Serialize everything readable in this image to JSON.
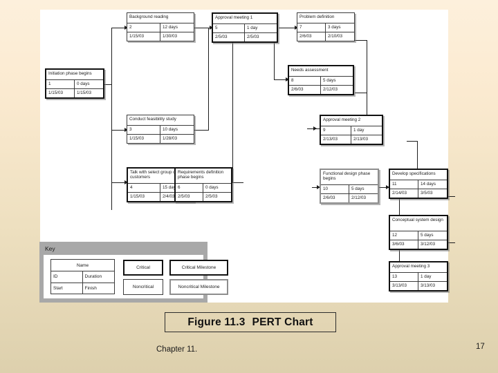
{
  "slide": {
    "caption_label": "Figure 11.3",
    "caption_text": "PERT Chart",
    "footer_chapter": "Chapter 11.",
    "page_number": "17",
    "background_top_color": "#fdf0dc",
    "background_bottom_color": "#ddd0ad",
    "canvas_color": "#ffffff"
  },
  "key": {
    "title": "Key",
    "panel_color": "#a8a8a8",
    "name_label": "Name",
    "id_label": "ID",
    "duration_label": "Duration",
    "start_label": "Start",
    "finish_label": "Finish",
    "critical_label": "Critical",
    "critical_milestone_label": "Critical Milestone",
    "noncritical_label": "Noncritical",
    "noncritical_milestone_label": "Noncritical Milestone",
    "critical_color": "#111111",
    "noncritical_color": "#3a3a3a",
    "noncritical_milestone_color": "#8d8d8d"
  },
  "chart_data": {
    "type": "diagram",
    "title": "PERT Chart",
    "nodes": [
      {
        "key": "initiation",
        "name": "Initiation phase begins",
        "id": "1",
        "duration": "0 days",
        "start": "1/15/03",
        "finish": "1/15/03",
        "style": "critical-milestone"
      },
      {
        "key": "background",
        "name": "Background reading",
        "id": "2",
        "duration": "12 days",
        "start": "1/15/03",
        "finish": "1/30/03",
        "style": "noncritical"
      },
      {
        "key": "feasibility",
        "name": "Conduct feasibility study",
        "id": "3",
        "duration": "10 days",
        "start": "1/15/03",
        "finish": "1/28/03",
        "style": "noncritical"
      },
      {
        "key": "customers",
        "name": "Talk with select group of customers",
        "id": "4",
        "duration": "15 days",
        "start": "1/15/03",
        "finish": "2/4/03",
        "style": "critical"
      },
      {
        "key": "approval1",
        "name": "Approval meeting 1",
        "id": "5",
        "duration": "1 day",
        "start": "2/5/03",
        "finish": "2/5/03",
        "style": "critical"
      },
      {
        "key": "requirements",
        "name": "Requirements definition phase begins",
        "id": "6",
        "duration": "0 days",
        "start": "2/5/03",
        "finish": "2/5/03",
        "style": "critical-milestone"
      },
      {
        "key": "problem",
        "name": "Problem definition",
        "id": "7",
        "duration": "3 days",
        "start": "2/6/03",
        "finish": "2/10/03",
        "style": "noncritical"
      },
      {
        "key": "needs",
        "name": "Needs assessment",
        "id": "8",
        "duration": "5 days",
        "start": "2/6/03",
        "finish": "2/12/03",
        "style": "critical"
      },
      {
        "key": "approval2",
        "name": "Approval meeting 2",
        "id": "9",
        "duration": "1 day",
        "start": "2/13/03",
        "finish": "2/13/03",
        "style": "critical"
      },
      {
        "key": "functional",
        "name": "Functional design phase begins",
        "id": "10",
        "duration": "5 days",
        "start": "2/6/03",
        "finish": "2/12/03",
        "style": "noncritical-milestone"
      },
      {
        "key": "specs",
        "name": "Develop specifications",
        "id": "11",
        "duration": "14 days",
        "start": "2/14/03",
        "finish": "3/5/03",
        "style": "critical"
      },
      {
        "key": "conceptual",
        "name": "Conceptual system design",
        "id": "12",
        "duration": "5 days",
        "start": "3/6/03",
        "finish": "3/12/03",
        "style": "critical"
      },
      {
        "key": "approval3",
        "name": "Approval meeting 3",
        "id": "13",
        "duration": "1 day",
        "start": "3/13/03",
        "finish": "3/13/03",
        "style": "critical"
      }
    ]
  }
}
